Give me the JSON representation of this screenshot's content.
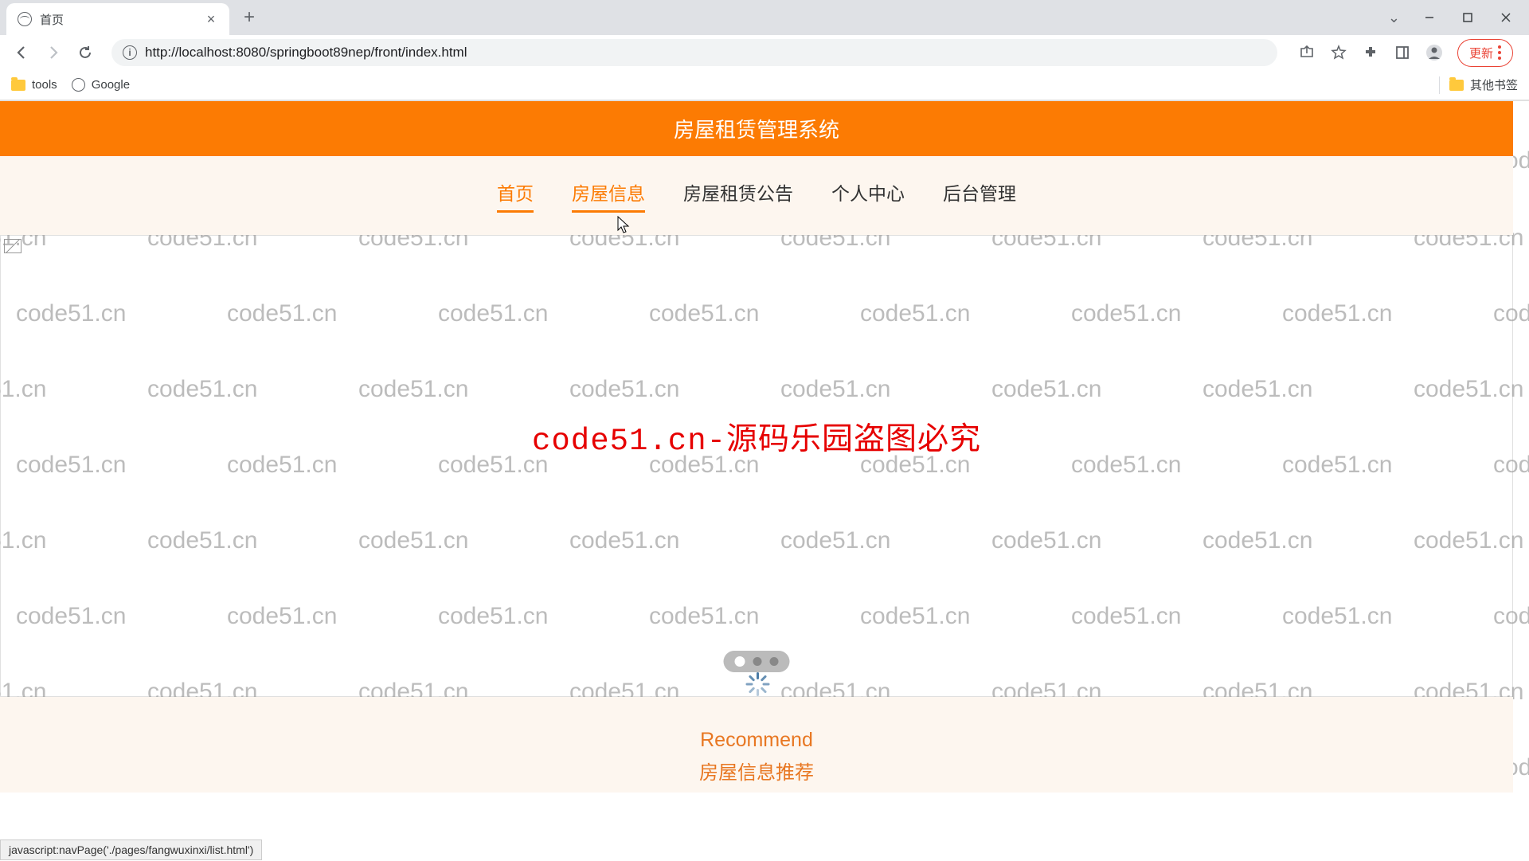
{
  "tab": {
    "title": "首页"
  },
  "url": "http://localhost:8080/springboot89nep/front/index.html",
  "bookmarks": {
    "tools": "tools",
    "google": "Google",
    "other": "其他书签"
  },
  "updateBtn": "更新",
  "header": {
    "title": "房屋租赁管理系统"
  },
  "nav": {
    "items": [
      "首页",
      "房屋信息",
      "房屋租赁公告",
      "个人中心",
      "后台管理"
    ]
  },
  "hero": {
    "watermark_text": "code51.cn-源码乐园盗图必究"
  },
  "recommend": {
    "en": "Recommend",
    "cn": "房屋信息推荐"
  },
  "statusBar": "javascript:navPage('./pages/fangwuxinxi/list.html')",
  "watermark": "code51.cn"
}
